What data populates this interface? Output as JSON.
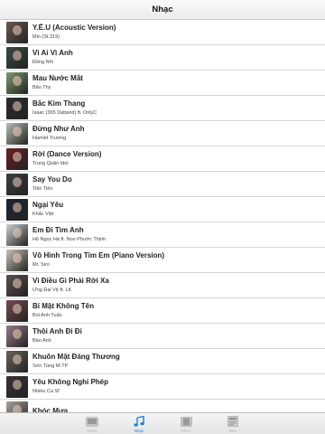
{
  "navbar": {
    "title": "Nhạc"
  },
  "songs": [
    {
      "title": "Y.Ê.U (Acoustic Version)",
      "artist": "Min (St.319)",
      "thumb": "#6a5a52"
    },
    {
      "title": "Vì Ai Vì Anh",
      "artist": "Đông Nhi",
      "thumb": "#3a4a42"
    },
    {
      "title": "Mau Nước Mắt",
      "artist": "Bảo Thy",
      "thumb": "#7e9a6a"
    },
    {
      "title": "Bắc Kim Thang",
      "artist": "Isaac (365 Daband)  ft. OnlyC",
      "thumb": "#2d2d35"
    },
    {
      "title": "Đừng Như Anh",
      "artist": "Hamlet Trương",
      "thumb": "#b9bdb2"
    },
    {
      "title": "Rời (Dance Version)",
      "artist": "Trung Quân Idol",
      "thumb": "#6b1f24"
    },
    {
      "title": "Say You Do",
      "artist": "Tiên Tiên",
      "thumb": "#3b3e44"
    },
    {
      "title": "Ngại Yêu",
      "artist": "Khắc Việt",
      "thumb": "#1e2430"
    },
    {
      "title": "Em Đi Tìm Anh",
      "artist": "Hồ Ngọc Hà  ft. Noo Phước Thịnh",
      "thumb": "#cfcfcf"
    },
    {
      "title": "Vô Hình Trong Tim Em (Piano Version)",
      "artist": "Mr. Siro",
      "thumb": "#c9c2b8"
    },
    {
      "title": "Vì Điều Gì Phải Rời Xa",
      "artist": "Ưng Đại Vệ  ft. LK",
      "thumb": "#5a5250"
    },
    {
      "title": "Bí Mật Không Tên",
      "artist": "Bùi Anh Tuấn",
      "thumb": "#7a4a52"
    },
    {
      "title": "Thôi Anh Đi Đi",
      "artist": "Bảo Anh",
      "thumb": "#9a7a8a"
    },
    {
      "title": "Khuôn Mặt Đáng Thương",
      "artist": "Sơn Tùng M-TP",
      "thumb": "#6a625a"
    },
    {
      "title": "Yêu Không Nghỉ Phép",
      "artist": "Nhiều Ca Sĩ",
      "thumb": "#3a3236"
    },
    {
      "title": "Khóc Mưa",
      "artist": "",
      "thumb": "#a8a4a0"
    }
  ],
  "tabs": [
    {
      "label": "Video",
      "icon": "video-icon"
    },
    {
      "label": "Nhạc",
      "icon": "music-note-icon",
      "active": true
    },
    {
      "label": "Phim",
      "icon": "film-icon"
    },
    {
      "label": "Báo",
      "icon": "newspaper-icon"
    }
  ],
  "colors": {
    "accent": "#1a7fe0",
    "inactive": "#b5b5b5"
  }
}
